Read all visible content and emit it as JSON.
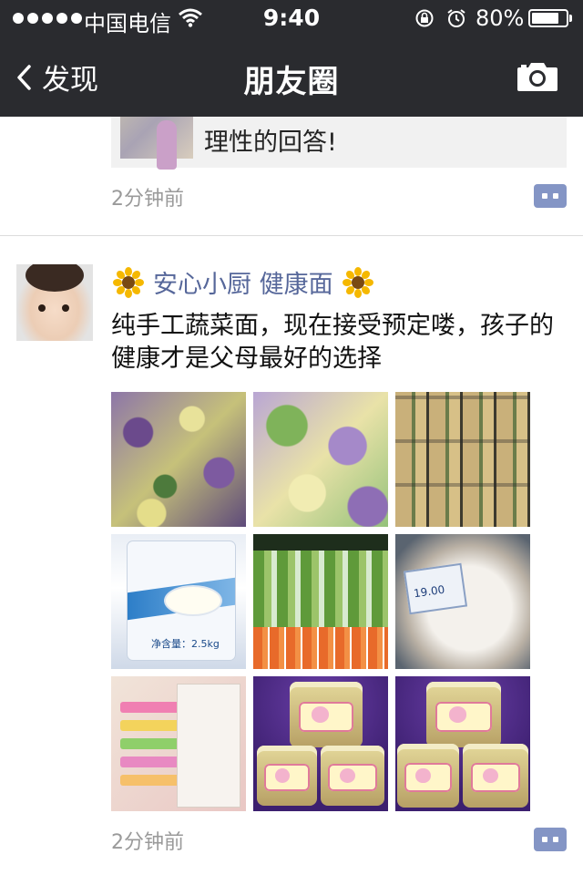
{
  "status_bar": {
    "carrier": "中国电信",
    "time": "9:40",
    "battery_text": "80%",
    "battery_level": 0.8
  },
  "nav": {
    "back_label": "发现",
    "title": "朋友圈",
    "camera_icon": "camera-icon"
  },
  "prev_post": {
    "share_text": "理性的回答!",
    "time": "2分钟前"
  },
  "post": {
    "author": "安心小厨 健康面",
    "text": "纯手工蔬菜面，现在接受预定喽，孩子的健康才是父母最好的选择",
    "time": "2分钟前",
    "photo_label_bag": "净含量：2.5kg",
    "photo_label_price": "19.00"
  },
  "colors": {
    "nav_bg": "#2a2b2f",
    "author_link": "#56679a",
    "comment_button": "#8495c5",
    "timestamp": "#9a9a9a"
  }
}
